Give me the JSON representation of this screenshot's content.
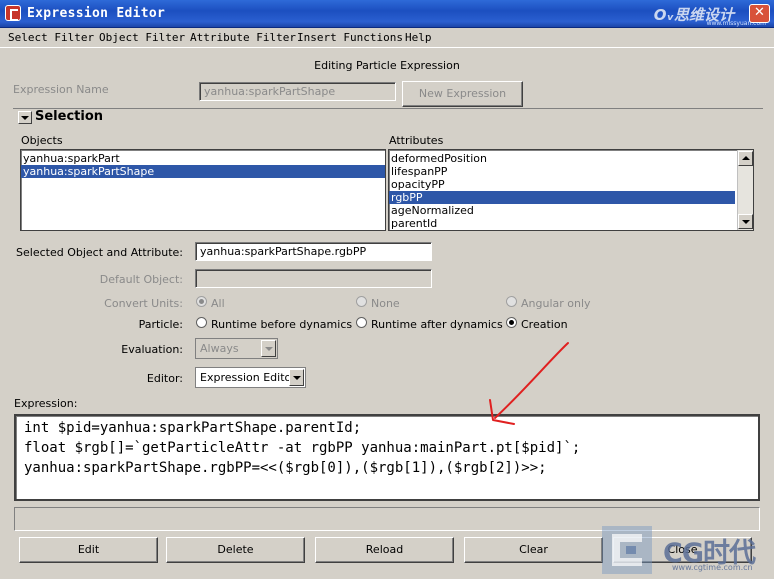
{
  "window": {
    "title": "Expression Editor",
    "watermark_top": "Oᵥ思维设计",
    "watermark_top_sub": "www.missyuan.com"
  },
  "menu": [
    "Select Filter",
    "Object Filter",
    "Attribute Filter",
    "Insert Functions",
    "Help"
  ],
  "header": {
    "editing_label": "Editing Particle Expression",
    "expression_name_label": "Expression Name",
    "expression_name_value": "yanhua:sparkPartShape",
    "new_expression_button": "New Expression"
  },
  "selection": {
    "title": "Selection",
    "objects_label": "Objects",
    "attributes_label": "Attributes",
    "objects": [
      {
        "label": "yanhua:sparkPart",
        "selected": false
      },
      {
        "label": "yanhua:sparkPartShape",
        "selected": true
      }
    ],
    "attributes": [
      {
        "label": "deformedPosition",
        "selected": false
      },
      {
        "label": "lifespanPP",
        "selected": false
      },
      {
        "label": "opacityPP",
        "selected": false
      },
      {
        "label": "rgbPP",
        "selected": true
      },
      {
        "label": "ageNormalized",
        "selected": false
      },
      {
        "label": "parentId",
        "selected": false
      }
    ]
  },
  "form": {
    "selected_label": "Selected Object and Attribute:",
    "selected_value": "yanhua:sparkPartShape.rgbPP",
    "default_object_label": "Default Object:",
    "default_object_value": "",
    "convert_units_label": "Convert Units:",
    "convert_units_options": [
      "All",
      "None",
      "Angular only"
    ],
    "particle_label": "Particle:",
    "particle_options": [
      "Runtime before dynamics",
      "Runtime after dynamics",
      "Creation"
    ],
    "evaluation_label": "Evaluation:",
    "evaluation_value": "Always",
    "editor_label": "Editor:",
    "editor_value": "Expression Editor"
  },
  "expression": {
    "label": "Expression:",
    "lines": [
      "int $pid=yanhua:sparkPartShape.parentId;",
      "float $rgb[]=`getParticleAttr -at rgbPP yanhua:mainPart.pt[$pid]`;",
      "yanhua:sparkPartShape.rgbPP=<<($rgb[0]),($rgb[1]),($rgb[2])>>;"
    ]
  },
  "buttons": [
    "Edit",
    "Delete",
    "Reload",
    "Clear",
    "Close"
  ],
  "watermark": {
    "brand": "CG时代",
    "url": "www.cgtime.com.cn"
  },
  "colors": {
    "selection_highlight": "#2e57a8",
    "annotation_arrow": "#e02020"
  }
}
